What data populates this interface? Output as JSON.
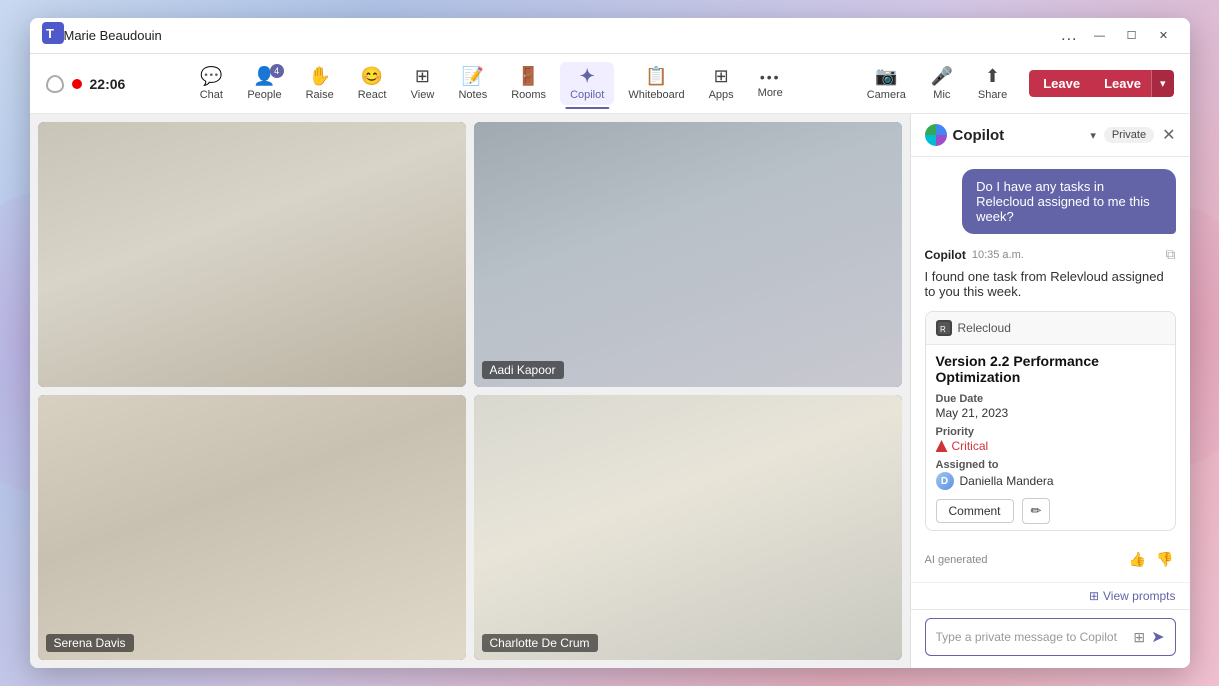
{
  "window": {
    "title": "Marie Beaudouin",
    "logo": "teams-logo"
  },
  "title_bar": {
    "dots_label": "...",
    "minimize": "—",
    "maximize": "☐",
    "close": "✕"
  },
  "toolbar": {
    "timer": "22:06",
    "tools": [
      {
        "id": "chat",
        "icon": "💬",
        "label": "Chat"
      },
      {
        "id": "people",
        "icon": "👤",
        "label": "People",
        "badge": "4"
      },
      {
        "id": "raise",
        "icon": "✋",
        "label": "Raise"
      },
      {
        "id": "react",
        "icon": "😊",
        "label": "React"
      },
      {
        "id": "view",
        "icon": "⊞",
        "label": "View"
      },
      {
        "id": "notes",
        "icon": "📝",
        "label": "Notes"
      },
      {
        "id": "rooms",
        "icon": "🚪",
        "label": "Rooms"
      },
      {
        "id": "copilot",
        "icon": "✦",
        "label": "Copilot",
        "active": true
      },
      {
        "id": "whiteboard",
        "icon": "📋",
        "label": "Whiteboard"
      },
      {
        "id": "apps",
        "icon": "⊞",
        "label": "Apps"
      },
      {
        "id": "more",
        "icon": "•••",
        "label": "More"
      }
    ],
    "camera_label": "Camera",
    "mic_label": "Mic",
    "share_label": "Share",
    "leave_label": "Leave"
  },
  "video_grid": {
    "participants": [
      {
        "id": "p1",
        "name": "",
        "active": false,
        "bg": "1"
      },
      {
        "id": "p2",
        "name": "Aadi Kapoor",
        "active": false,
        "bg": "2"
      },
      {
        "id": "p3",
        "name": "Serena Davis",
        "active": false,
        "bg": "3"
      },
      {
        "id": "p4",
        "name": "Charlotte De Crum",
        "active": true,
        "bg": "4"
      }
    ]
  },
  "copilot": {
    "title": "Copilot",
    "dropdown_arrow": "▾",
    "private_badge": "Private",
    "close_btn": "✕",
    "user_message": "Do I have any tasks in Relecloud assigned to me this week?",
    "copilot_sender": "Copilot",
    "copilot_time": "10:35 a.m.",
    "copilot_copy_icon": "⧉",
    "copilot_response": "I found one task from Relevloud assigned to you this week.",
    "task_card": {
      "app_name": "Relecloud",
      "task_title": "Version 2.2 Performance Optimization",
      "due_date_label": "Due Date",
      "due_date_value": "May 21, 2023",
      "priority_label": "Priority",
      "priority_value": "Critical",
      "assigned_label": "Assigned to",
      "assigned_name": "Daniella Mandera",
      "comment_btn": "Comment",
      "pencil_btn": "✏"
    },
    "ai_generated_label": "AI generated",
    "thumbs_up": "👍",
    "thumbs_down": "👎",
    "view_prompts_icon": "⊞",
    "view_prompts_label": "View prompts",
    "input_placeholder": "Type a private message to Copilot",
    "input_icon1": "⊞",
    "send_icon": "➤"
  }
}
